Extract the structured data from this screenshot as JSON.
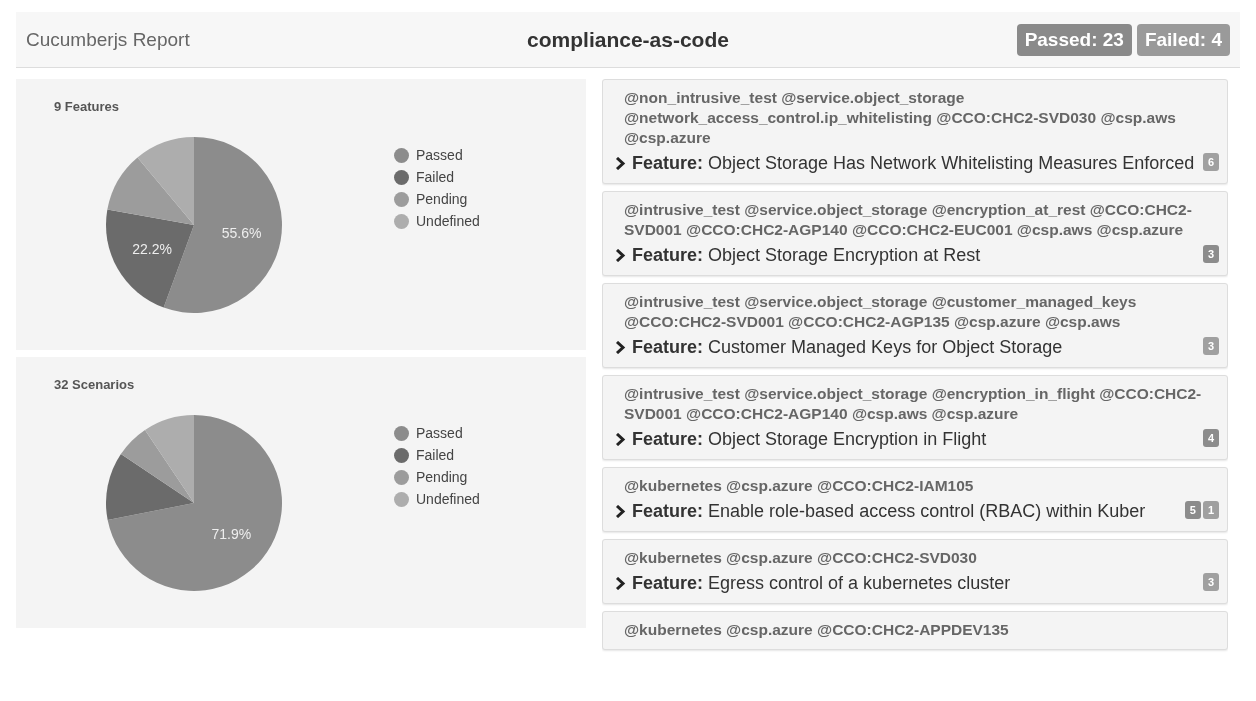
{
  "header": {
    "title": "Cucumberjs Report",
    "project": "compliance-as-code",
    "summary": [
      {
        "label": "Passed: 23",
        "kind": "passed"
      },
      {
        "label": "Failed: 4",
        "kind": "failed"
      }
    ]
  },
  "charts": [
    {
      "chart_data": {
        "type": "pie",
        "title": "9 Features",
        "categories": [
          "Passed",
          "Failed",
          "Pending",
          "Undefined"
        ],
        "values": [
          55.6,
          22.2,
          11.1,
          11.1
        ],
        "value_labels": [
          "55.6%",
          "22.2%",
          null,
          null
        ]
      },
      "legend": [
        {
          "color": "#8c8c8c"
        },
        {
          "color": "#6b6b6b"
        },
        {
          "color": "#9c9c9c"
        },
        {
          "color": "#adadad"
        }
      ]
    },
    {
      "chart_data": {
        "type": "pie",
        "title": "32 Scenarios",
        "categories": [
          "Passed",
          "Failed",
          "Pending",
          "Undefined"
        ],
        "values": [
          71.9,
          12.5,
          6.2,
          9.4
        ],
        "value_labels": [
          "71.9%",
          null,
          null,
          null
        ]
      },
      "legend": [
        {
          "color": "#8c8c8c"
        },
        {
          "color": "#6b6b6b"
        },
        {
          "color": "#9c9c9c"
        },
        {
          "color": "#adadad"
        }
      ]
    }
  ],
  "features": [
    {
      "tags": "@non_intrusive_test @service.object_storage @network_access_control.ip_whitelisting @CCO:CHC2-SVD030 @csp.aws @csp.azure",
      "keyword": "Feature:",
      "name": "Object Storage Has Network Whitelisting Measures Enforced",
      "badges": [
        {
          "label": "6",
          "color": "#a0a0a0"
        }
      ]
    },
    {
      "tags": "@intrusive_test @service.object_storage @encryption_at_rest @CCO:CHC2-SVD001 @CCO:CHC2-AGP140 @CCO:CHC2-EUC001 @csp.aws @csp.azure",
      "keyword": "Feature:",
      "name": "Object Storage Encryption at Rest",
      "badges": [
        {
          "label": "3",
          "color": "#8c8c8c"
        }
      ]
    },
    {
      "tags": "@intrusive_test @service.object_storage @customer_managed_keys @CCO:CHC2-SVD001 @CCO:CHC2-AGP135 @csp.azure @csp.aws",
      "keyword": "Feature:",
      "name": "Customer Managed Keys for Object Storage",
      "badges": [
        {
          "label": "3",
          "color": "#a0a0a0"
        }
      ]
    },
    {
      "tags": "@intrusive_test @service.object_storage @encryption_in_flight @CCO:CHC2-SVD001 @CCO:CHC2-AGP140 @csp.aws @csp.azure",
      "keyword": "Feature:",
      "name": "Object Storage Encryption in Flight",
      "badges": [
        {
          "label": "4",
          "color": "#8c8c8c"
        }
      ]
    },
    {
      "tags": "@kubernetes @csp.azure @CCO:CHC2-IAM105",
      "keyword": "Feature:",
      "name": "Enable role-based access control (RBAC) within Kuber",
      "badges": [
        {
          "label": "5",
          "color": "#8c8c8c"
        },
        {
          "label": "1",
          "color": "#a0a0a0"
        }
      ]
    },
    {
      "tags": "@kubernetes @csp.azure @CCO:CHC2-SVD030",
      "keyword": "Feature:",
      "name": "Egress control of a kubernetes cluster",
      "badges": [
        {
          "label": "3",
          "color": "#a0a0a0"
        }
      ]
    },
    {
      "tags": "@kubernetes @csp.azure @CCO:CHC2-APPDEV135"
    }
  ]
}
